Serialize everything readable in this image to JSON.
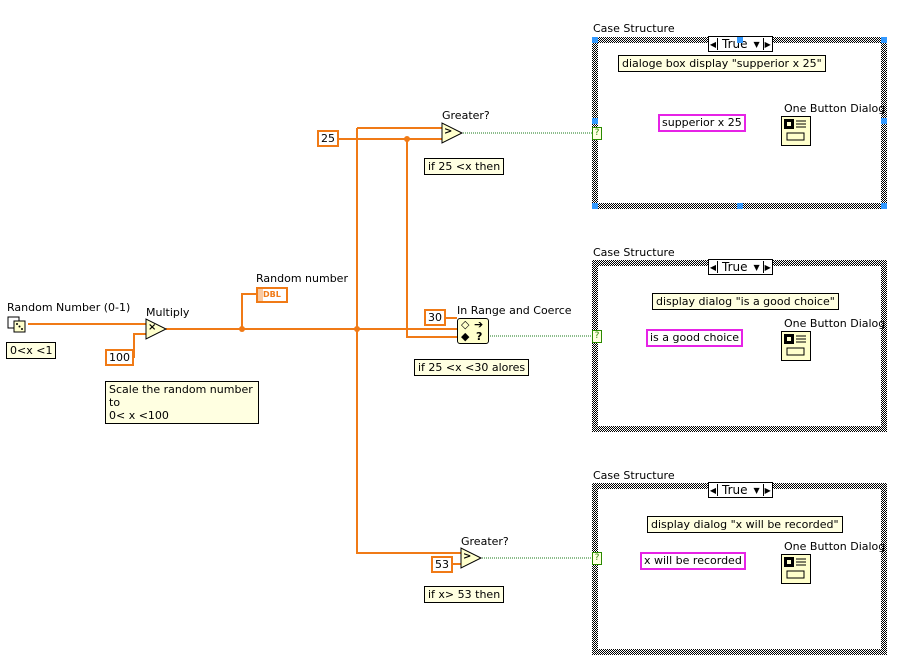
{
  "diagram": {
    "random_node": {
      "label": "Random Number (0-1)",
      "icon": "dice-icon",
      "comment": "0<x <1"
    },
    "multiply": {
      "label": "Multiply",
      "symbol": "×",
      "constant": "100",
      "comment_line1": "Scale the random number to",
      "comment_line2": "0< x <100"
    },
    "indicator": {
      "label": "Random number",
      "type": "DBL"
    },
    "greater1": {
      "label": "Greater?",
      "symbol": ">",
      "constant": "25",
      "comment": "if 25 <x then"
    },
    "in_range": {
      "label": "In Range and Coerce",
      "constant": "30",
      "comment": "if 25 <x <30 alores"
    },
    "greater2": {
      "label": "Greater?",
      "symbol": ">",
      "constant": "53",
      "comment": "if x> 53 then"
    },
    "selector_terminal": "?",
    "cases": [
      {
        "title": "Case Structure",
        "selector_value": "True",
        "comment": "dialoge box display \"supperior x 25\"",
        "string_constant": "supperior x 25",
        "dialog_label": "One Button Dialog"
      },
      {
        "title": "Case Structure",
        "selector_value": "True",
        "comment": "display dialog \"is a good choice\"",
        "string_constant": "is a good choice",
        "dialog_label": "One Button Dialog"
      },
      {
        "title": "Case Structure",
        "selector_value": "True",
        "comment": "display dialog \"x will be recorded\"",
        "string_constant": "x will be recorded",
        "dialog_label": "One Button Dialog"
      }
    ],
    "colors": {
      "numeric_wire": "#f07a16",
      "boolean_wire": "#1a7a1a",
      "string_wire": "#e623e6",
      "comment_bg": "#ffffe1",
      "selection_handle": "#3399ff"
    }
  }
}
